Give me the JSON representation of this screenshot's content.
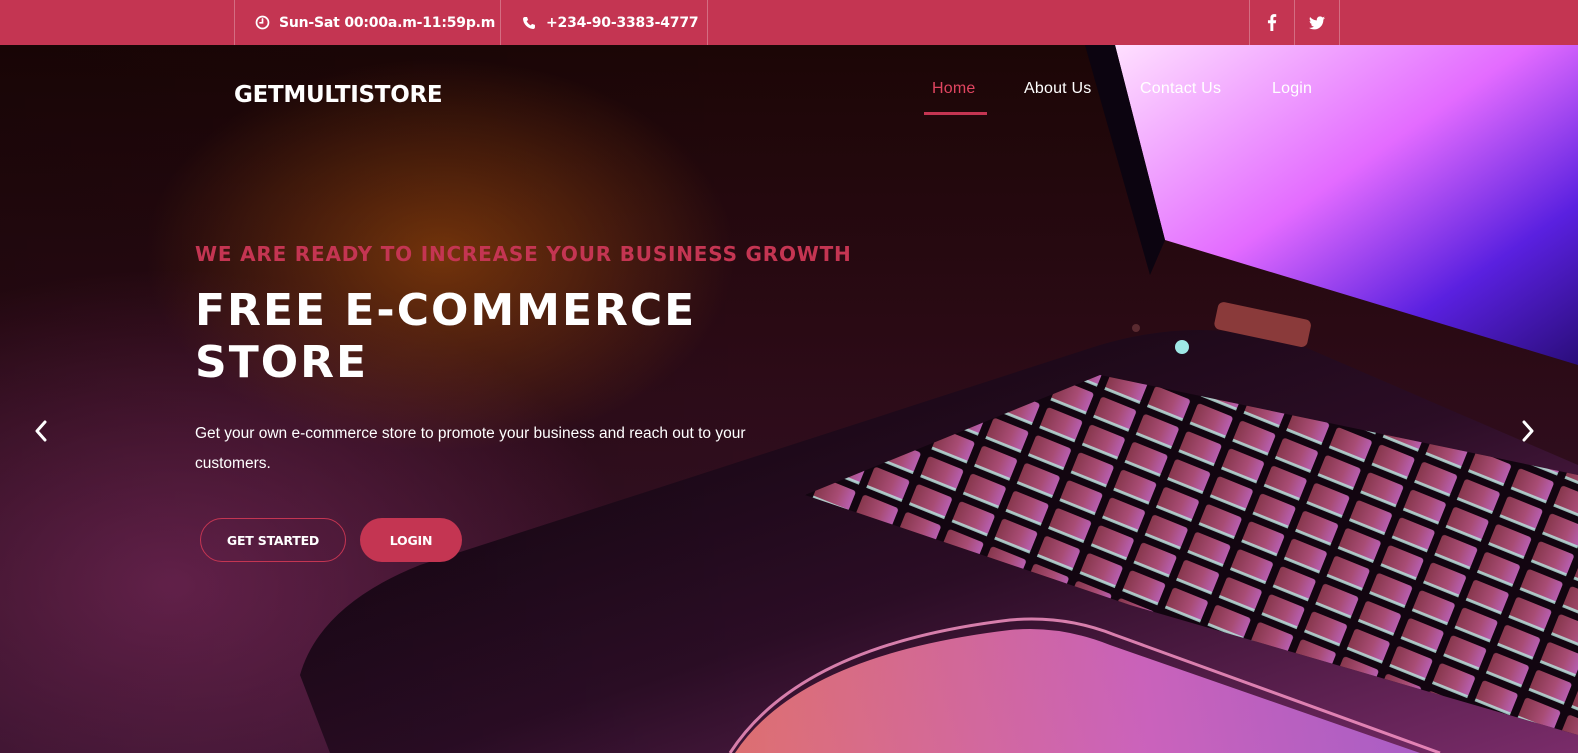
{
  "topbar": {
    "hours": "Sun-Sat 00:00a.m-11:59p.m",
    "hours_icon": "clock-icon",
    "phone": "+234-90-3383-4777",
    "phone_icon": "phone-icon",
    "social": [
      "facebook-icon",
      "twitter-icon"
    ]
  },
  "brand": {
    "logo": "GETMULTISTORE"
  },
  "nav": {
    "items": [
      {
        "label": "Home",
        "active": true
      },
      {
        "label": "About Us",
        "active": false
      },
      {
        "label": "Contact Us",
        "active": false
      },
      {
        "label": "Login",
        "active": false
      }
    ]
  },
  "hero": {
    "eyebrow": "WE ARE READY TO INCREASE YOUR BUSINESS GROWTH",
    "headline_line1": "FREE E-COMMERCE",
    "headline_line2": "STORE",
    "lead": "Get your own e-commerce store to promote your business and reach out to your customers.",
    "primary_button": "GET STARTED",
    "secondary_button": "LOGIN",
    "prev_icon": "chevron-left-icon",
    "next_icon": "chevron-right-icon"
  },
  "colors": {
    "accent": "#c43552",
    "text": "#ffffff"
  }
}
